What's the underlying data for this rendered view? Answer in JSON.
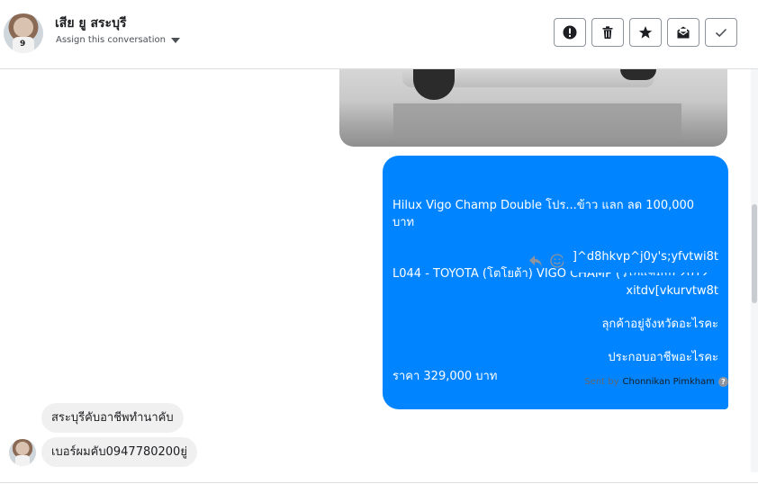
{
  "header": {
    "contact_name": "เสีย ยู สระบุรี",
    "assign_label": "Assign this conversation",
    "avatar_number": "9",
    "toolbar": [
      {
        "name": "mark-spam-button",
        "icon": "exclamation-icon"
      },
      {
        "name": "delete-button",
        "icon": "trash-icon"
      },
      {
        "name": "star-button",
        "icon": "star-icon"
      },
      {
        "name": "mark-unread-button",
        "icon": "envelope-icon"
      },
      {
        "name": "mark-done-button",
        "icon": "checkmark-icon"
      }
    ]
  },
  "messages": {
    "outgoing": {
      "listing_line1": "Hilux Vigo Champ Double โปร...ข้าว แลก ลด 100,000 บาท",
      "listing_line2": "L044 - TOYOTA (โตโยต้า) VIGO CHAMP (วีโก้แชมป์) 2012",
      "listing_price": "ราคา 329,000 บาท",
      "msg2": "]^d8hkvp^j0y's;yfvtwi8t",
      "msg3": "xitdv[vkurvtw8t",
      "msg4": "ลุกค้าอยู่จังหวัดอะไรคะ",
      "msg5": "ประกอบอาชีพอะไรคะ"
    },
    "sent_by_prefix": "Sent by",
    "sent_by_agent": "Chonnikan Pimkham",
    "incoming": {
      "msg1": "สระบุรีคับอาชีพทำนาคับ",
      "msg2": "เบอร์ผมคับ0947780200ยู่"
    }
  },
  "colors": {
    "outgoing_bubble": "#0084ff",
    "incoming_bubble": "#f1f0f0"
  }
}
